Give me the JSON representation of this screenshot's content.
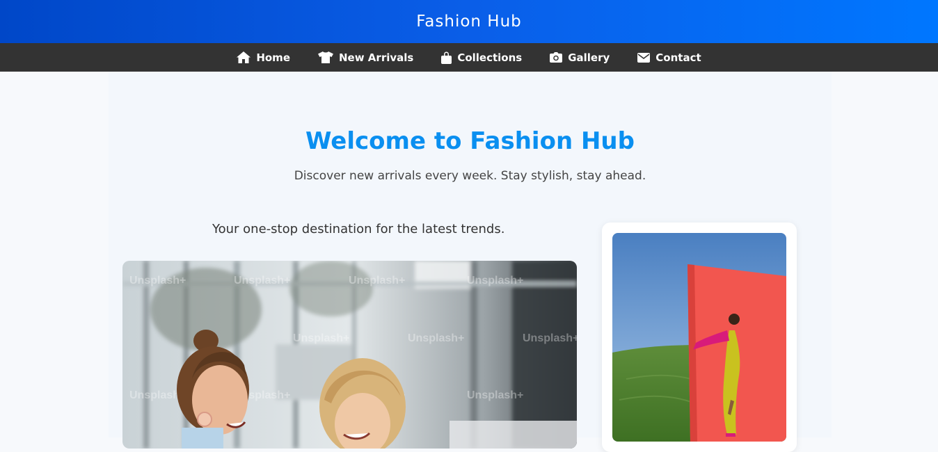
{
  "header": {
    "brand": "Fashion Hub"
  },
  "nav": {
    "items": [
      {
        "label": "Home",
        "icon": "home-icon"
      },
      {
        "label": "New Arrivals",
        "icon": "tshirt-icon"
      },
      {
        "label": "Collections",
        "icon": "shopping-bag-icon"
      },
      {
        "label": "Gallery",
        "icon": "camera-icon"
      },
      {
        "label": "Contact",
        "icon": "envelope-icon"
      }
    ]
  },
  "hero": {
    "title": "Welcome to Fashion Hub",
    "subtitle": "Discover new arrivals every week. Stay stylish, stay ahead."
  },
  "content": {
    "tagline": "Your one-stop destination for the latest trends.",
    "main_image_watermark": "Unsplash+"
  },
  "colors": {
    "header_start": "#0047c8",
    "header_end": "#0077ff",
    "nav_bg": "#333333",
    "title": "#0a8ff0"
  }
}
